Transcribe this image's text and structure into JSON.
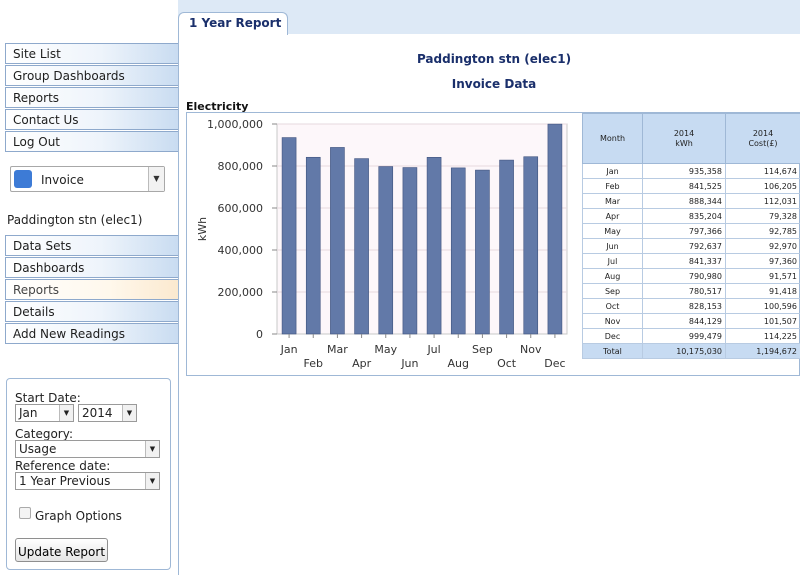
{
  "tab": {
    "label": "1 Year Report"
  },
  "nav": {
    "top": [
      "Site List",
      "Group Dashboards",
      "Reports",
      "Contact Us",
      "Log Out"
    ],
    "invoice_label": "Invoice",
    "site_name": "Paddington stn (elec1)",
    "site": [
      "Data Sets",
      "Dashboards",
      "Reports",
      "Details",
      "Add New Readings"
    ]
  },
  "options": {
    "start_date_label": "Start Date:",
    "month": "Jan",
    "year": "2014",
    "category_label": "Category:",
    "category": "Usage",
    "reference_label": "Reference date:",
    "reference": "1 Year Previous",
    "graph_options_label": "Graph Options",
    "update_button": "Update Report"
  },
  "report": {
    "site_title": "Paddington stn (elec1)",
    "subtitle": "Invoice Data",
    "section": "Electricity"
  },
  "table": {
    "headers": [
      "Month",
      "2014",
      "kWh",
      "2014",
      "Cost(£)"
    ],
    "rows": [
      [
        "Jan",
        "935,358",
        "114,674"
      ],
      [
        "Feb",
        "841,525",
        "106,205"
      ],
      [
        "Mar",
        "888,344",
        "112,031"
      ],
      [
        "Apr",
        "835,204",
        "79,328"
      ],
      [
        "May",
        "797,366",
        "92,785"
      ],
      [
        "Jun",
        "792,637",
        "92,970"
      ],
      [
        "Jul",
        "841,337",
        "97,360"
      ],
      [
        "Aug",
        "790,980",
        "91,571"
      ],
      [
        "Sep",
        "780,517",
        "91,418"
      ],
      [
        "Oct",
        "828,153",
        "100,596"
      ],
      [
        "Nov",
        "844,129",
        "101,507"
      ],
      [
        "Dec",
        "999,479",
        "114,225"
      ]
    ],
    "total": [
      "Total",
      "10,175,030",
      "1,194,672"
    ]
  },
  "chart_data": {
    "type": "bar",
    "categories": [
      "Jan",
      "Feb",
      "Mar",
      "Apr",
      "May",
      "Jun",
      "Jul",
      "Aug",
      "Sep",
      "Oct",
      "Nov",
      "Dec"
    ],
    "values": [
      935358,
      841525,
      888344,
      835204,
      797366,
      792637,
      841337,
      790980,
      780517,
      828153,
      844129,
      999479
    ],
    "ylabel": "kWh",
    "ylim": [
      0,
      1000000
    ],
    "yticks": [
      "0",
      "200,000",
      "400,000",
      "600,000",
      "800,000",
      "1,000,000"
    ],
    "bar_color": "#6279a8",
    "grid": true
  }
}
